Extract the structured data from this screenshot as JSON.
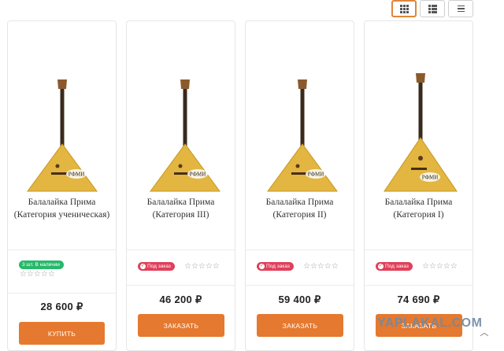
{
  "view_toggles": [
    {
      "name": "grid",
      "icon": "grid-icon",
      "active": true
    },
    {
      "name": "list",
      "icon": "list-icon",
      "active": false
    },
    {
      "name": "compact",
      "icon": "lines-icon",
      "active": false
    }
  ],
  "products": [
    {
      "title": "Балалайка Прима (Категория ученическая)",
      "badge": "3 шт. В наличии",
      "badge_type": "instock",
      "rating": 0,
      "stars": "☆☆☆☆☆",
      "price": "28 600 ₽",
      "button": "КУПИТЬ"
    },
    {
      "title": "Балалайка Прима (Категория III)",
      "badge": "Под заказ",
      "badge_type": "order",
      "rating": 0,
      "stars": "☆☆☆☆☆",
      "price": "46 200 ₽",
      "button": "ЗАКАЗАТЬ"
    },
    {
      "title": "Балалайка Прима (Категория II)",
      "badge": "Под заказ",
      "badge_type": "order",
      "rating": 0,
      "stars": "☆☆☆☆☆",
      "price": "59 400 ₽",
      "button": "ЗАКАЗАТЬ"
    },
    {
      "title": "Балалайка Прима (Категория I)",
      "badge": "Под заказ",
      "badge_type": "order",
      "rating": 0,
      "stars": "☆☆☆☆☆",
      "price": "74 690 ₽",
      "button": "ЗАКАЗАТЬ"
    }
  ],
  "logo_text": "РФМИ",
  "watermark": "YAPLAKAL.COM",
  "colors": {
    "accent": "#e5792f",
    "instock": "#27b96b",
    "order": "#e0405a",
    "wood": "#e2b640"
  }
}
